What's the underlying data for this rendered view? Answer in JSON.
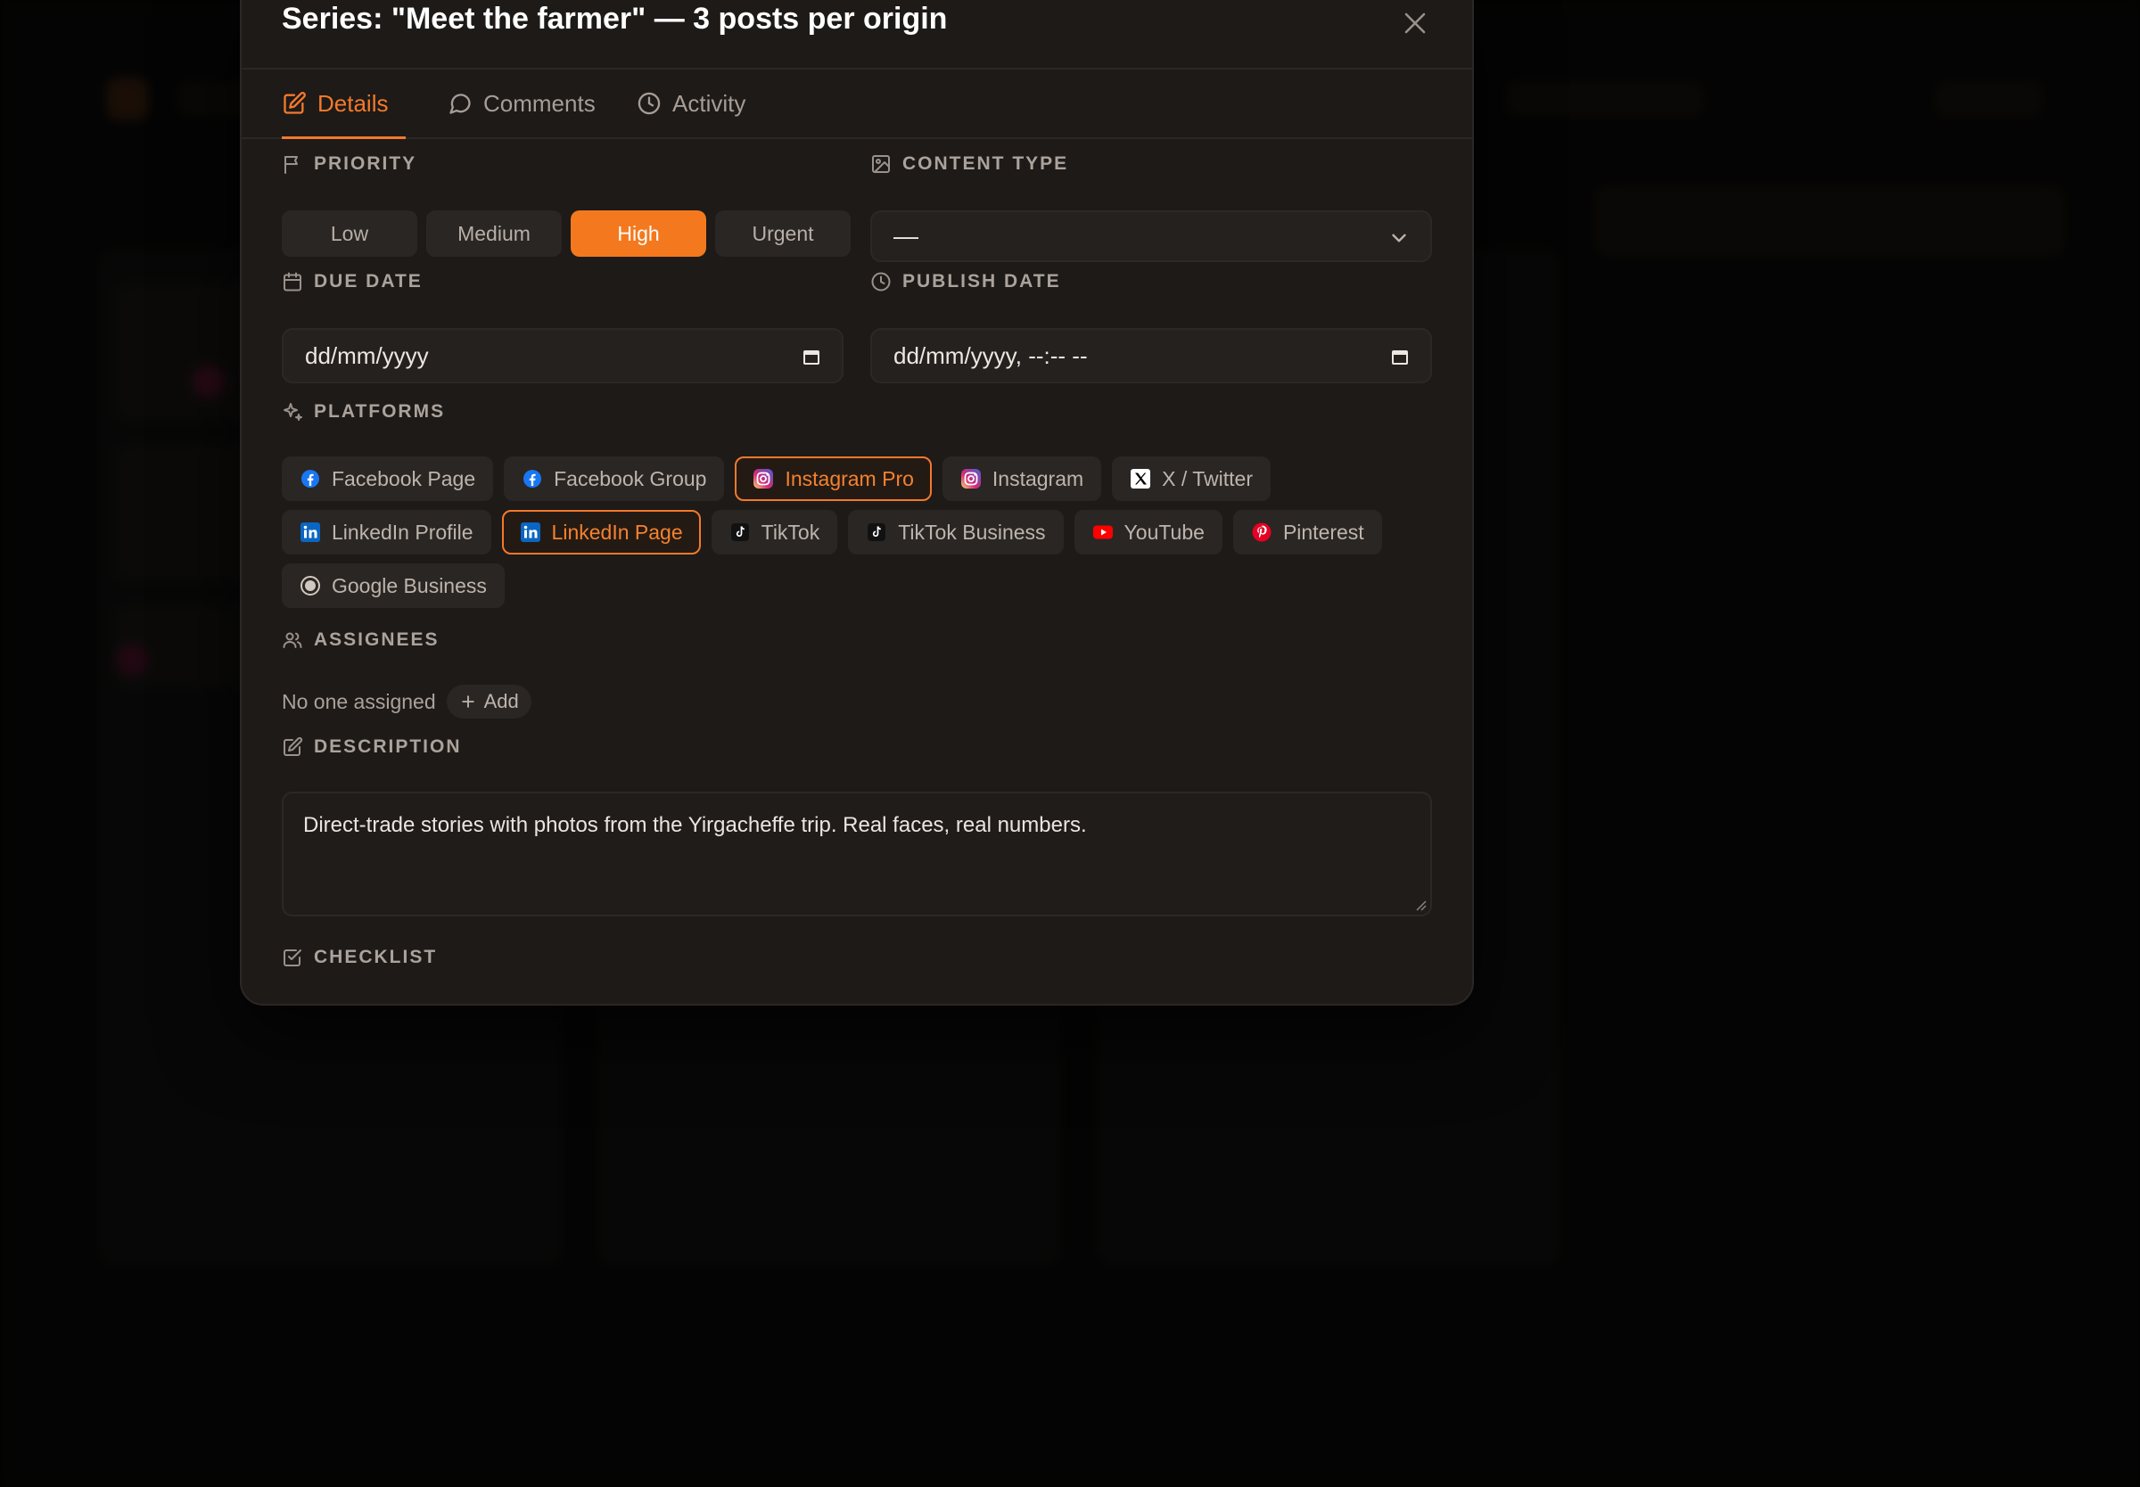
{
  "modal": {
    "title": "Series: \"Meet the farmer\" — 3 posts per origin",
    "tabs": [
      {
        "label": "Details",
        "icon": "edit-icon",
        "active": true
      },
      {
        "label": "Comments",
        "icon": "chat-bubble-icon",
        "active": false
      },
      {
        "label": "Activity",
        "icon": "clock-icon",
        "active": false
      }
    ]
  },
  "priority": {
    "label": "PRIORITY",
    "options": [
      "Low",
      "Medium",
      "High",
      "Urgent"
    ],
    "selected": "High"
  },
  "content_type": {
    "label": "CONTENT TYPE",
    "value": "—"
  },
  "due_date": {
    "label": "DUE DATE",
    "placeholder": "dd/mm/yyyy"
  },
  "publish_date": {
    "label": "PUBLISH DATE",
    "placeholder": "dd/mm/yyyy, --:-- --"
  },
  "platforms": {
    "label": "PLATFORMS",
    "items": [
      {
        "label": "Facebook Page",
        "icon": "facebook-icon",
        "selected": false
      },
      {
        "label": "Facebook Group",
        "icon": "facebook-icon",
        "selected": false
      },
      {
        "label": "Instagram Pro",
        "icon": "instagram-icon",
        "selected": true
      },
      {
        "label": "Instagram",
        "icon": "instagram-icon",
        "selected": false
      },
      {
        "label": "X / Twitter",
        "icon": "x-icon",
        "selected": false
      },
      {
        "label": "LinkedIn Profile",
        "icon": "linkedin-icon",
        "selected": false
      },
      {
        "label": "LinkedIn Page",
        "icon": "linkedin-icon",
        "selected": true
      },
      {
        "label": "TikTok",
        "icon": "tiktok-icon",
        "selected": false
      },
      {
        "label": "TikTok Business",
        "icon": "tiktok-icon",
        "selected": false
      },
      {
        "label": "YouTube",
        "icon": "youtube-icon",
        "selected": false
      },
      {
        "label": "Pinterest",
        "icon": "pinterest-icon",
        "selected": false
      },
      {
        "label": "Google Business",
        "icon": "google-business-icon",
        "selected": false
      }
    ]
  },
  "assignees": {
    "label": "ASSIGNEES",
    "empty_text": "No one assigned",
    "add_label": "Add"
  },
  "description": {
    "label": "DESCRIPTION",
    "text": "Direct-trade stories with photos from the Yirgacheffe trip. Real faces, real numbers."
  },
  "checklist": {
    "label": "CHECKLIST"
  },
  "colors": {
    "accent": "#f4792b",
    "modal_bg": "#1d1a18",
    "backdrop": "#080706"
  }
}
